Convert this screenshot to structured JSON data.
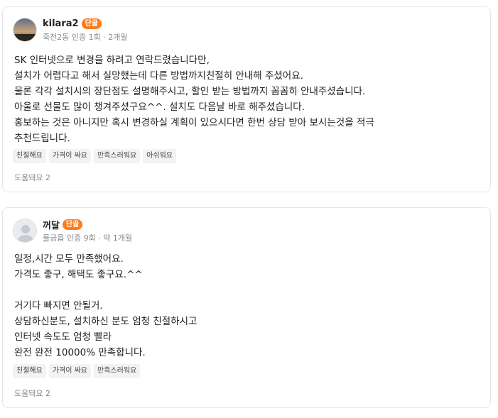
{
  "reviews": [
    {
      "author": "kilara2",
      "badge": "단골",
      "meta": "죽전2동 인증 1회 · 2개월",
      "body": "SK 인터넷으로 변경을 하려고 연락드렸습니다만,\n설치가 어렵다고 해서 실망했는데 다른 방법까지친절히 안내해 주셨어요.\n물론 각각 설치시의 장단점도 설명해주시고, 할인 받는 방법까지 꼼꼼히 안내주셨습니다.\n아울로 선물도 많이 챙겨주셨구요^^. 설치도 다음날 바로 해주셨습니다.\n홍보하는 것은 아니지만 혹시 변경하실 계획이 있으시다면 한번 상담 받아 보시는것을 적극\n추천드립니다.",
      "tags": [
        "친절해요",
        "가격이 싸요",
        "만족스러워요",
        "아쉬워요"
      ],
      "helpful": "도움돼요 2"
    },
    {
      "author": "꺼달",
      "badge": "단골",
      "meta": "물금읍 인증 9회 · 약 1개월",
      "body": "일정,시간 모두 만족했어요.\n가격도 좋구, 해택도 좋구요.^^\n\n거기다 빠지면 안될거.\n상담하신분도, 설치하신 분도 엄청 친절하시고\n인터넷 속도도 엄청 빨라\n완전 완전 10000% 만족합니다.",
      "tags": [
        "친절해요",
        "가격이 싸요",
        "만족스러워요"
      ],
      "helpful": "도움돼요 2"
    }
  ]
}
